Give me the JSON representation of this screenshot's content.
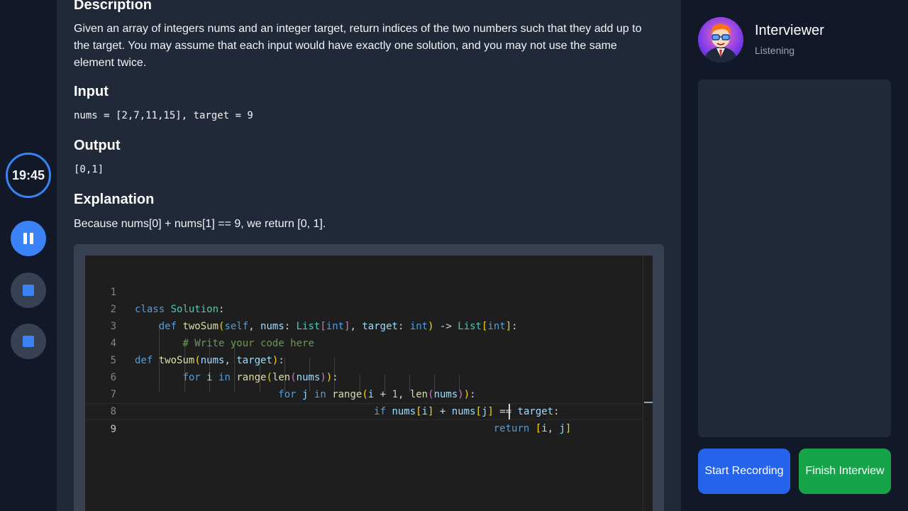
{
  "timer": "19:45",
  "problem": {
    "description_heading": "Description",
    "description_text": "Given an array of integers nums and an integer target, return indices of the two numbers such that they add up to the target. You may assume that each input would have exactly one solution, and you may not use the same element twice.",
    "input_heading": "Input",
    "input_value": "nums = [2,7,11,15], target = 9",
    "output_heading": "Output",
    "output_value": "[0,1]",
    "explanation_heading": "Explanation",
    "explanation_text": "Because nums[0] + nums[1] == 9, we return [0, 1]."
  },
  "editor": {
    "line_numbers": [
      "1",
      "2",
      "3",
      "4",
      "5",
      "6",
      "7",
      "8",
      "9"
    ],
    "current_line": "9"
  },
  "interviewer": {
    "name": "Interviewer",
    "status": "Listening"
  },
  "actions": {
    "start_recording": "Start Recording",
    "finish_interview": "Finish Interview"
  },
  "icons": {
    "pause": "pause-icon",
    "stop": "stop-icon"
  },
  "colors": {
    "accent": "#3b82f6",
    "start_button": "#2563eb",
    "finish_button": "#16a34a"
  }
}
